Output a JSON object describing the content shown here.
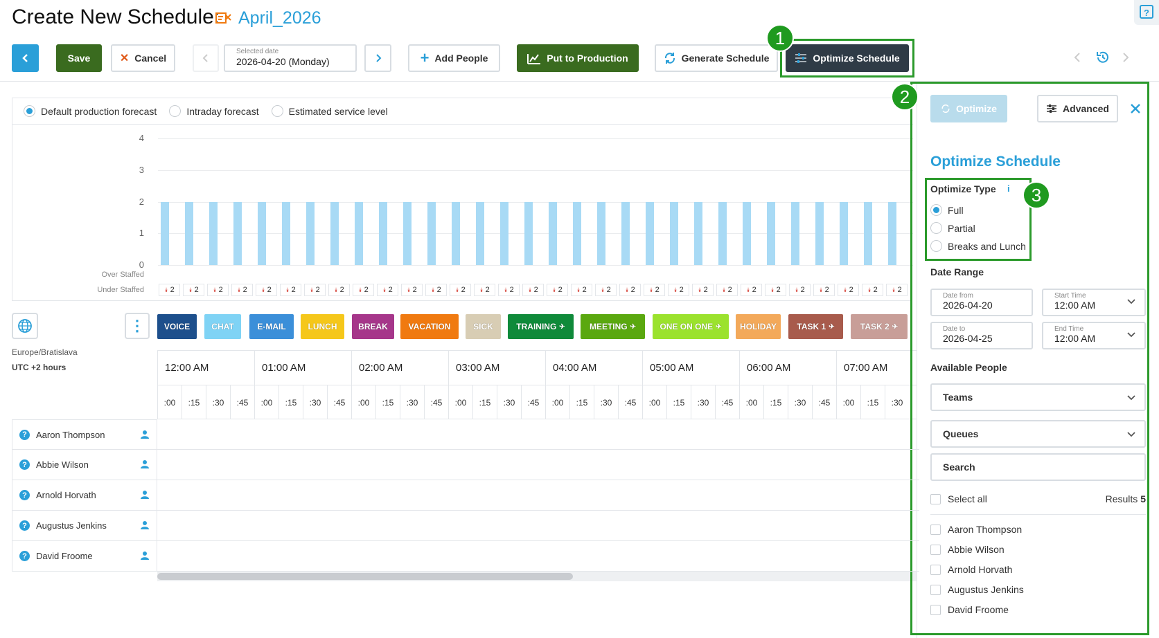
{
  "header": {
    "title": "Create New Schedule:",
    "schedule_name": "April_2026"
  },
  "toolbar": {
    "save_label": "Save",
    "cancel_label": "Cancel",
    "selected_date_label": "Selected date",
    "selected_date_value": "2026-04-20 (Monday)",
    "add_people_label": "Add People",
    "put_to_production_label": "Put to Production",
    "generate_schedule_label": "Generate Schedule",
    "optimize_schedule_label": "Optimize Schedule"
  },
  "annotations": [
    "1",
    "2",
    "3"
  ],
  "forecast": {
    "tabs": [
      {
        "label": "Default production forecast",
        "selected": true
      },
      {
        "label": "Intraday forecast",
        "selected": false
      },
      {
        "label": "Estimated service level",
        "selected": false
      }
    ],
    "y_ticks": [
      "4",
      "3",
      "2",
      "1",
      "0"
    ],
    "over_staffed_label": "Over Staffed",
    "under_staffed_label": "Under Staffed"
  },
  "chart_data": {
    "type": "bar",
    "ylim": [
      0,
      4
    ],
    "values": [
      2,
      2,
      2,
      2,
      2,
      2,
      2,
      2,
      2,
      2,
      2,
      2,
      2,
      2,
      2,
      2,
      2,
      2,
      2,
      2,
      2,
      2,
      2,
      2,
      2,
      2,
      2,
      2,
      2,
      2,
      2
    ],
    "under_staffed": [
      "2",
      "2",
      "2",
      "2",
      "2",
      "2",
      "2",
      "2",
      "2",
      "2",
      "2",
      "2",
      "2",
      "2",
      "2",
      "2",
      "2",
      "2",
      "2",
      "2",
      "2",
      "2",
      "2",
      "2",
      "2",
      "2",
      "2",
      "2",
      "2",
      "2",
      "2"
    ]
  },
  "activity_tags": [
    {
      "label": "VOICE",
      "color": "#1d4f8c"
    },
    {
      "label": "CHAT",
      "color": "#7fd3f5"
    },
    {
      "label": "E-MAIL",
      "color": "#3b8fd9"
    },
    {
      "label": "LUNCH",
      "color": "#f5c71a"
    },
    {
      "label": "BREAK",
      "color": "#a6368a"
    },
    {
      "label": "VACATION",
      "color": "#f07a10"
    },
    {
      "label": "SICK",
      "color": "#d8cdb4"
    },
    {
      "label": "TRAINING",
      "color": "#0f8a3a",
      "pin": true
    },
    {
      "label": "MEETING",
      "color": "#5aa80f",
      "pin": true
    },
    {
      "label": "ONE ON ONE",
      "color": "#9be22d",
      "pin": true
    },
    {
      "label": "HOLIDAY",
      "color": "#f3a95a"
    },
    {
      "label": "TASK 1",
      "color": "#a85b4c",
      "pin": true
    },
    {
      "label": "TASK 2",
      "color": "#c89e98",
      "pin": true
    }
  ],
  "timezone": {
    "name": "Europe/Bratislava",
    "offset": "UTC +2 hours"
  },
  "hours": [
    "12:00 AM",
    "01:00 AM",
    "02:00 AM",
    "03:00 AM",
    "04:00 AM",
    "05:00 AM",
    "06:00 AM",
    "07:00 AM"
  ],
  "minutes": [
    ":00",
    ":15",
    ":30",
    ":45"
  ],
  "people": [
    "Aaron Thompson",
    "Abbie Wilson",
    "Arnold Horvath",
    "Augustus Jenkins",
    "David Froome"
  ],
  "panel": {
    "optimize_label": "Optimize",
    "advanced_label": "Advanced",
    "title": "Optimize Schedule",
    "optimize_type_label": "Optimize Type",
    "optimize_types": [
      {
        "label": "Full",
        "selected": true
      },
      {
        "label": "Partial",
        "selected": false
      },
      {
        "label": "Breaks and Lunch",
        "selected": false
      }
    ],
    "date_range_label": "Date Range",
    "date_from_label": "Date from",
    "date_from_value": "2026-04-20",
    "start_time_label": "Start Time",
    "start_time_value": "12:00 AM",
    "date_to_label": "Date to",
    "date_to_value": "2026-04-25",
    "end_time_label": "End Time",
    "end_time_value": "12:00 AM",
    "available_people_label": "Available People",
    "teams_label": "Teams",
    "queues_label": "Queues",
    "search_label": "Search",
    "select_all_label": "Select all",
    "results_label": "Results",
    "results_count": "5",
    "people": [
      "Aaron Thompson",
      "Abbie Wilson",
      "Arnold Horvath",
      "Augustus Jenkins",
      "David Froome"
    ]
  },
  "colors": {
    "accent": "#2a9fd8",
    "save": "#3a6b1f",
    "optimize_button": "#2f3b46",
    "annotation": "#2b9a2b"
  }
}
